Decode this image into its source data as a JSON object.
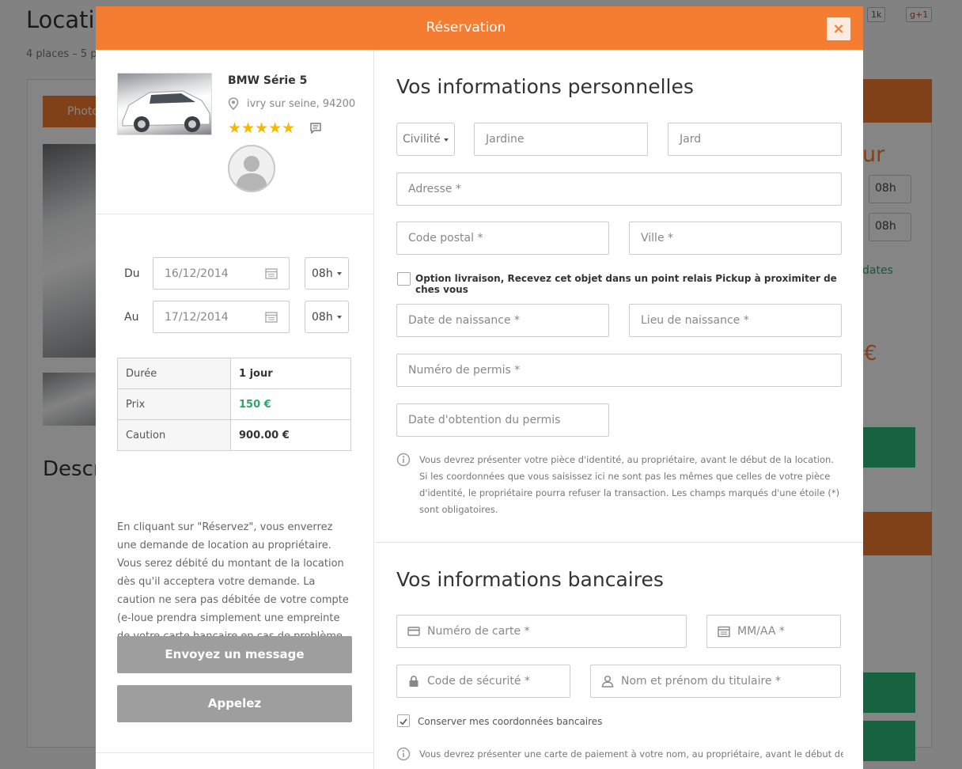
{
  "background": {
    "title": "Locatio",
    "subtitle": "4 places  –  5 p",
    "photo_tab": "Photo",
    "description": "Descr",
    "right_text_1": "ur",
    "right_text_2": "€",
    "hour_1": "08h",
    "hour_2": "08h",
    "dates_link": "dates",
    "social_1": "1k",
    "social_2": "g+1"
  },
  "modal": {
    "title": "Réservation",
    "close_label": "×"
  },
  "car": {
    "name": "BMW Série 5",
    "location": "ivry sur seine, 94200",
    "rating": "★★★★★"
  },
  "booking": {
    "from_label": "Du",
    "from_date": "16/12/2014",
    "from_hour": "08h",
    "to_label": "Au",
    "to_date": "17/12/2014",
    "to_hour": "08h"
  },
  "summary": [
    {
      "label": "Durée",
      "value": "1 jour"
    },
    {
      "label": "Prix",
      "value": "150 €"
    },
    {
      "label": "Caution",
      "value": "900.00 €"
    }
  ],
  "notice_left": "En cliquant sur \"Réservez\", vous enverrez une demande de location au propriétaire. Vous serez débité du montant de la location dès qu'il acceptera votre demande. La caution ne sera pas débitée de votre compte (e-loue prendra simplement une empreinte de votre carte bancaire en cas de problème pendant la location).",
  "buttons": {
    "message": "Envoyez un message",
    "call": "Appelez"
  },
  "personal": {
    "title": "Vos informations personnelles",
    "civility": "Civilité",
    "first_name_value": "Jardine",
    "last_name_value": "Jard",
    "address_placeholder": "Adresse *",
    "zip_placeholder": "Code postal *",
    "city_placeholder": "Ville *",
    "delivery_option": "Option livraison, Recevez cet objet dans un point relais Pickup à proximiter de ches vous",
    "birth_date_placeholder": "Date de naissance *",
    "birth_place_placeholder": "Lieu de naissance *",
    "license_placeholder": "Numéro de permis *",
    "license_date_placeholder": "Date d'obtention du permis",
    "info_text": "Vous devrez présenter votre pièce d'identité, au propriétaire, avant le début de la location. Si les coordonnées que vous saisissez ici ne sont pas les mêmes que celles de votre pièce d'identité, le propriétaire pourra refuser la transaction. Les champs marqués d'une étoile (*) sont obligatoires."
  },
  "banking": {
    "title": "Vos informations bancaires",
    "card_number_placeholder": "Numéro de carte *",
    "expiry_placeholder": "MM/AA *",
    "cvc_placeholder": "Code de sécurité *",
    "holder_placeholder": "Nom et prénom du titulaire *",
    "save_card": "Conserver mes coordonnées bancaires",
    "info_text": "Vous devrez présenter une carte de paiement à votre nom, au propriétaire, avant le début de la"
  },
  "colors": {
    "accent": "#f57d31",
    "green": "#2fa56d",
    "button_grey": "#9e9e9e"
  }
}
